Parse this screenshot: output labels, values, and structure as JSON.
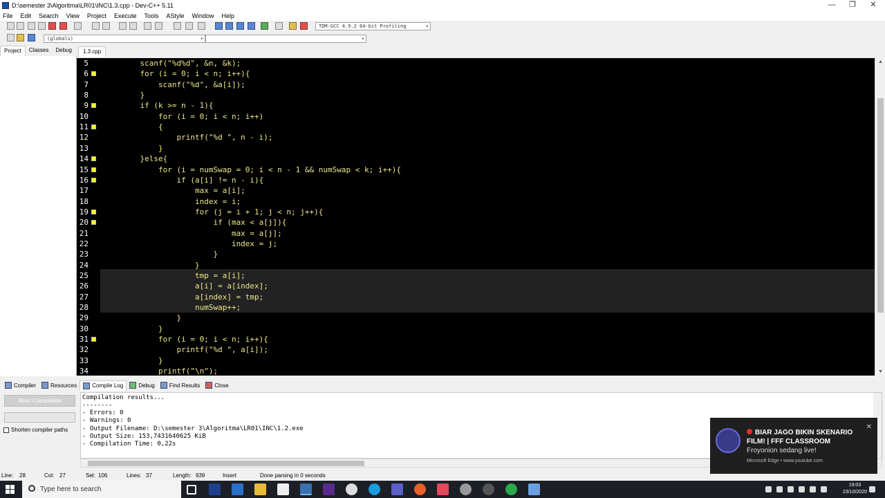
{
  "window": {
    "title": "D:\\semester 3\\Algoritma\\LR01\\INC\\1.3.cpp - Dev-C++ 5.11",
    "minimize": "—",
    "maximize": "❐",
    "close": "✕"
  },
  "menu": [
    "File",
    "Edit",
    "Search",
    "View",
    "Project",
    "Execute",
    "Tools",
    "AStyle",
    "Window",
    "Help"
  ],
  "toolbar": {
    "compiler_select": "TDM-GCC 4.9.2 64-bit Profiling",
    "scope_select": "(globals)",
    "function_select": ""
  },
  "left_panel": {
    "tabs": [
      "Project",
      "Classes",
      "Debug"
    ]
  },
  "editor": {
    "file_tab": "1.3.cpp",
    "lines": [
      {
        "n": "5",
        "code": "    scanf(\"%d%d\", &n, &k);",
        "fold": false
      },
      {
        "n": "6",
        "code": "    for (i = 0; i < n; i++){",
        "fold": true
      },
      {
        "n": "7",
        "code": "        scanf(\"%d\", &a[i]);",
        "fold": false
      },
      {
        "n": "8",
        "code": "    }",
        "fold": false
      },
      {
        "n": "9",
        "code": "    if (k >= n - 1){",
        "fold": true
      },
      {
        "n": "10",
        "code": "        for (i = 0; i < n; i++)",
        "fold": false
      },
      {
        "n": "11",
        "code": "        {",
        "fold": true
      },
      {
        "n": "12",
        "code": "            printf(\"%d \", n - i);",
        "fold": false
      },
      {
        "n": "13",
        "code": "        }",
        "fold": false
      },
      {
        "n": "14",
        "code": "    }else{",
        "fold": true
      },
      {
        "n": "15",
        "code": "        for (i = numSwap = 0; i < n - 1 && numSwap < k; i++){",
        "fold": true
      },
      {
        "n": "16",
        "code": "            if (a[i] != n - i){",
        "fold": true
      },
      {
        "n": "17",
        "code": "                max = a[i];",
        "fold": false
      },
      {
        "n": "18",
        "code": "                index = i;",
        "fold": false
      },
      {
        "n": "19",
        "code": "                for (j = i + 1; j < n; j++){",
        "fold": true
      },
      {
        "n": "20",
        "code": "                    if (max < a[j]){",
        "fold": true
      },
      {
        "n": "21",
        "code": "                        max = a[j];",
        "fold": false
      },
      {
        "n": "22",
        "code": "                        index = j;",
        "fold": false
      },
      {
        "n": "23",
        "code": "                    }",
        "fold": false
      },
      {
        "n": "24",
        "code": "                }",
        "fold": false
      },
      {
        "n": "25",
        "code": "                tmp = a[i];",
        "fold": false
      },
      {
        "n": "26",
        "code": "                a[i] = a[index];",
        "fold": false
      },
      {
        "n": "27",
        "code": "                a[index] = tmp;",
        "fold": false
      },
      {
        "n": "28",
        "code": "                numSwap++;",
        "fold": false
      },
      {
        "n": "29",
        "code": "            }",
        "fold": false
      },
      {
        "n": "30",
        "code": "        }",
        "fold": false
      },
      {
        "n": "31",
        "code": "        for (i = 0; i < n; i++){",
        "fold": true
      },
      {
        "n": "32",
        "code": "            printf(\"%d \", a[i]);",
        "fold": false
      },
      {
        "n": "33",
        "code": "        }",
        "fold": false
      },
      {
        "n": "34",
        "code": "        printf(\"\\n\");",
        "fold": false
      }
    ]
  },
  "bottom_panel": {
    "tabs": [
      "Compiler",
      "Resources",
      "Compile Log",
      "Debug",
      "Find Results",
      "Close"
    ],
    "abort_button": "Abort Compilation",
    "shorten_label": "Shorten compiler paths",
    "log": [
      "Compilation results...",
      "--------",
      "- Errors: 0",
      "- Warnings: 0",
      "- Output Filename: D:\\semester 3\\Algoritma\\LR01\\INC\\1.2.exe",
      "- Output Size: 153,7431640625 KiB",
      "- Compilation Time: 0,22s"
    ]
  },
  "status": {
    "line": "Line:",
    "line_val": "28",
    "col": "Col:",
    "col_val": "27",
    "sel": "Sel:",
    "sel_val": "106",
    "lines": "Lines:",
    "lines_val": "37",
    "length": "Length:",
    "length_val": "939",
    "mode": "Insert",
    "message": "Done parsing in 0 seconds"
  },
  "toast": {
    "title": "BIAR JAGO BIKIN SKENARIO FILM! | FFF CLASSROOM",
    "subtitle": "Froyonion sedang live!",
    "source": "Microsoft Edge • www.youtube.com",
    "close": "✕"
  },
  "taskbar": {
    "search_placeholder": "Type here to search",
    "time": "19:03",
    "date": "23/10/2020"
  }
}
